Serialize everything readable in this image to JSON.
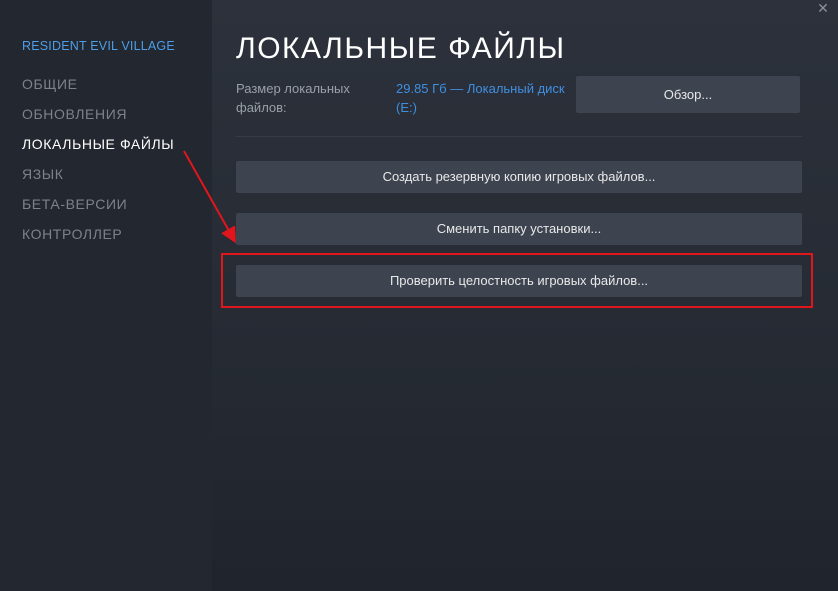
{
  "sidebar": {
    "game_title": "RESIDENT EVIL VILLAGE",
    "items": [
      {
        "label": "ОБЩИЕ",
        "active": false
      },
      {
        "label": "ОБНОВЛЕНИЯ",
        "active": false
      },
      {
        "label": "ЛОКАЛЬНЫЕ ФАЙЛЫ",
        "active": true
      },
      {
        "label": "ЯЗЫК",
        "active": false
      },
      {
        "label": "БЕТА-ВЕРСИИ",
        "active": false
      },
      {
        "label": "КОНТРОЛЛЕР",
        "active": false
      }
    ]
  },
  "main": {
    "title": "ЛОКАЛЬНЫЕ ФАЙЛЫ",
    "size_label": "Размер локальных файлов:",
    "size_value": "29.85 Гб — Локальный диск (E:)",
    "browse_label": "Обзор...",
    "backup_label": "Создать резервную копию игровых файлов...",
    "move_label": "Сменить папку установки...",
    "verify_label": "Проверить целостность игровых файлов..."
  },
  "window": {
    "close_icon": "close-icon"
  },
  "colors": {
    "accent_blue": "#4c9ee8",
    "highlight_red": "#e0161c",
    "button_bg": "#3d4450"
  }
}
